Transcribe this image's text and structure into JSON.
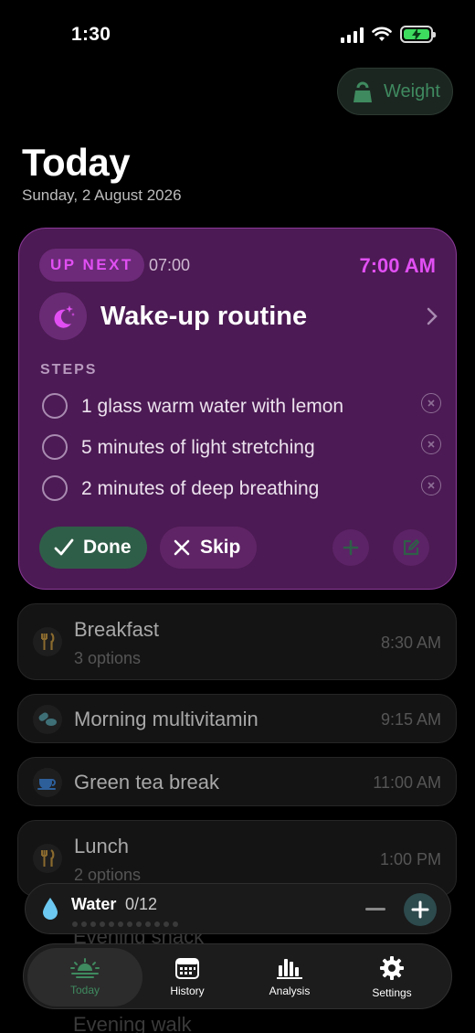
{
  "status": {
    "time": "1:30"
  },
  "weight": {
    "label": "Weight"
  },
  "header": {
    "title": "Today",
    "date": "Sunday, 2 August 2026"
  },
  "up_next": {
    "badge": "UP NEXT",
    "badge_time": "07:00",
    "time": "7:00 AM",
    "title": "Wake-up routine",
    "steps_label": "STEPS",
    "steps": [
      {
        "text": "1 glass warm water with lemon"
      },
      {
        "text": "5 minutes of light stretching"
      },
      {
        "text": "2 minutes of deep breathing"
      }
    ],
    "done_label": "Done",
    "skip_label": "Skip"
  },
  "schedule": [
    {
      "title": "Breakfast",
      "subtitle": "3 options",
      "time": "8:30 AM"
    },
    {
      "title": "Morning multivitamin",
      "time": "9:15 AM"
    },
    {
      "title": "Green tea break",
      "time": "11:00 AM"
    },
    {
      "title": "Lunch",
      "subtitle": "2 options",
      "time": "1:00 PM"
    },
    {
      "title": "Evening snack"
    },
    {
      "title": "Evening walk"
    }
  ],
  "water": {
    "label": "Water",
    "count": "0/12"
  },
  "tabs": [
    {
      "label": "Today",
      "icon": "sunrise-icon"
    },
    {
      "label": "History",
      "icon": "calendar-icon"
    },
    {
      "label": "Analysis",
      "icon": "bar-chart-icon"
    },
    {
      "label": "Settings",
      "icon": "gear-icon"
    }
  ],
  "colors": {
    "accent": "#e14ff3",
    "card": "#4c1a54",
    "green": "#3f8a5f"
  }
}
